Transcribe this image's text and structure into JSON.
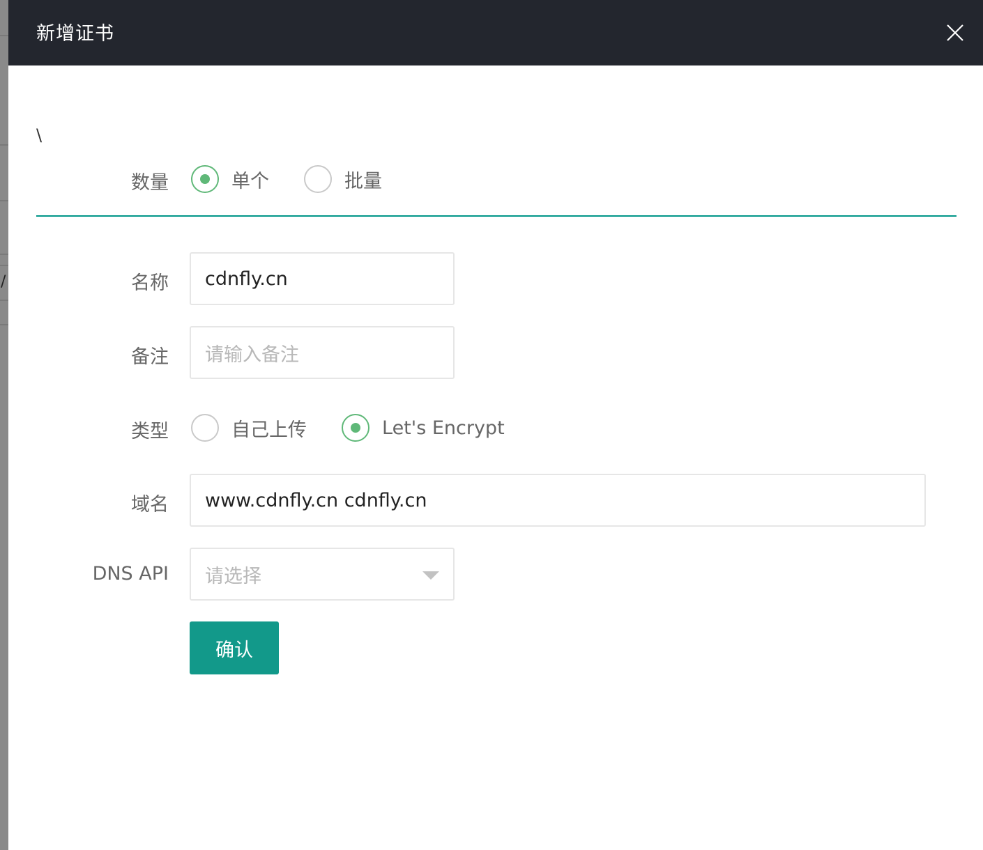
{
  "dialog": {
    "title": "新增证书",
    "stray_text": "\\"
  },
  "background": {
    "glyph": "/"
  },
  "form": {
    "quantity": {
      "label": "数量",
      "options": [
        {
          "label": "单个",
          "selected": true
        },
        {
          "label": "批量",
          "selected": false
        }
      ]
    },
    "name": {
      "label": "名称",
      "value": "cdnfly.cn"
    },
    "remark": {
      "label": "备注",
      "value": "",
      "placeholder": "请输入备注"
    },
    "type": {
      "label": "类型",
      "options": [
        {
          "label": "自己上传",
          "selected": false
        },
        {
          "label": "Let's Encrypt",
          "selected": true
        }
      ]
    },
    "domain": {
      "label": "域名",
      "value": "www.cdnfly.cn cdnfly.cn"
    },
    "dns_api": {
      "label": "DNS API",
      "placeholder": "请选择"
    },
    "submit_label": "确认"
  },
  "colors": {
    "titlebar": "#23262e",
    "accent": "#009688",
    "radio_on": "#5fb878",
    "button": "#12998a"
  }
}
